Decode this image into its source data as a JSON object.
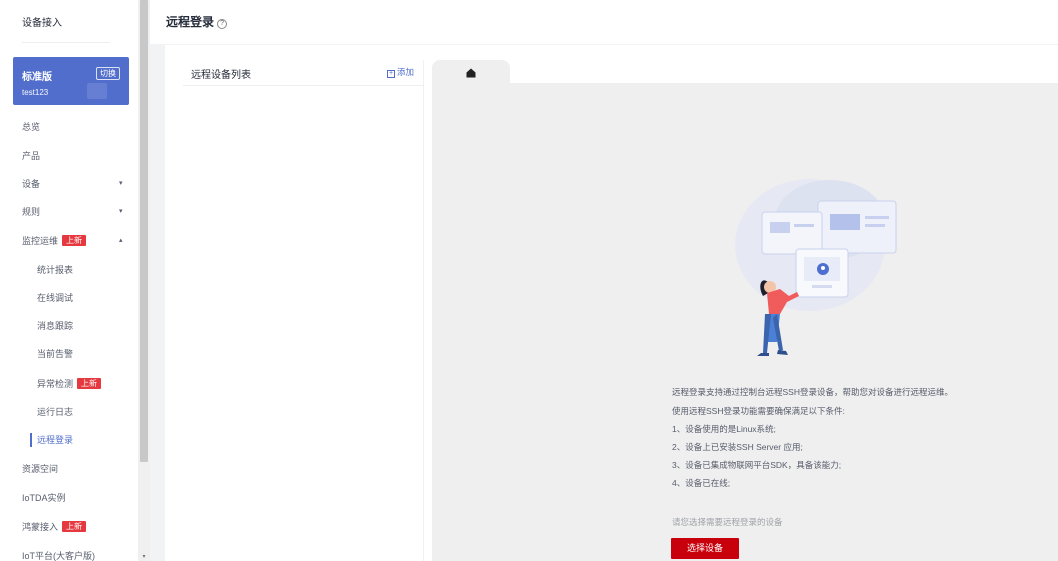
{
  "sidebar": {
    "brand": "设备接入",
    "edition": {
      "name": "标准版",
      "switch": "切换",
      "user": "test123"
    },
    "items": [
      {
        "label": "总览"
      },
      {
        "label": "产品"
      },
      {
        "label": "设备",
        "chevron": "▾"
      },
      {
        "label": "规则",
        "chevron": "▾"
      },
      {
        "label": "监控运维",
        "badge": "上新",
        "chevron": "▴"
      },
      {
        "label": "统计报表"
      },
      {
        "label": "在线调试"
      },
      {
        "label": "消息跟踪"
      },
      {
        "label": "当前告警"
      },
      {
        "label": "异常检测",
        "badge": "上新"
      },
      {
        "label": "运行日志"
      },
      {
        "label": "远程登录"
      },
      {
        "label": "资源空间"
      },
      {
        "label": "IoTDA实例"
      },
      {
        "label": "鸿蒙接入",
        "badge": "上新"
      },
      {
        "label": "IoT平台(大客户版)"
      }
    ]
  },
  "header": {
    "title": "远程登录",
    "help": "?"
  },
  "list_panel": {
    "title": "远程设备列表",
    "add_label": "添加",
    "add_icon": "+"
  },
  "terminal": {
    "tab_icon": "home-icon",
    "description": [
      "远程登录支持通过控制台远程SSH登录设备，帮助您对设备进行远程运维。",
      "使用远程SSH登录功能需要确保满足以下条件:",
      "1、设备使用的是Linux系统;",
      "2、设备上已安装SSH Server 应用;",
      "3、设备已集成物联网平台SDK，具备该能力;",
      "4、设备已在线;"
    ],
    "hint": "请您选择需要远程登录的设备",
    "select_button": "选择设备"
  },
  "colors": {
    "accent": "#526ecc",
    "primary_button": "#c7000b",
    "badge": "#e6393f"
  }
}
